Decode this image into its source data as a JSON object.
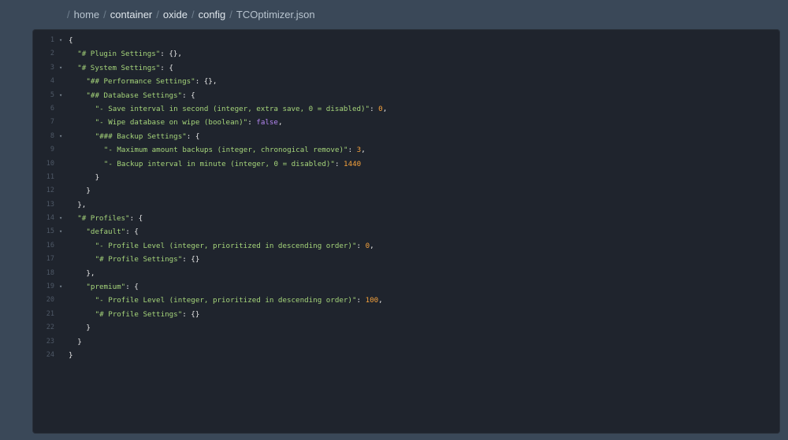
{
  "breadcrumb": {
    "segments": [
      {
        "label": "home",
        "weight": "dim"
      },
      {
        "label": "container",
        "weight": "strong"
      },
      {
        "label": "oxide",
        "weight": "strong"
      },
      {
        "label": "config",
        "weight": "strong"
      },
      {
        "label": "TCOptimizer.json",
        "weight": "dim"
      }
    ],
    "separator": "/"
  },
  "colors": {
    "background": "#3a4858",
    "editor": "#1f242d",
    "string": "#a5d47a",
    "number": "#f4a13c",
    "boolean": "#b385f0"
  },
  "editor": {
    "file": "TCOptimizer.json",
    "lines": [
      {
        "n": "1",
        "fold": true,
        "indent": 0,
        "tokens": [
          [
            "p",
            "{"
          ]
        ]
      },
      {
        "n": "2",
        "fold": false,
        "indent": 1,
        "tokens": [
          [
            "s",
            "\"# Plugin Settings\""
          ],
          [
            "p",
            ": {},"
          ]
        ]
      },
      {
        "n": "3",
        "fold": true,
        "indent": 1,
        "tokens": [
          [
            "s",
            "\"# System Settings\""
          ],
          [
            "p",
            ": {"
          ]
        ]
      },
      {
        "n": "4",
        "fold": false,
        "indent": 2,
        "tokens": [
          [
            "s",
            "\"## Performance Settings\""
          ],
          [
            "p",
            ": {},"
          ]
        ]
      },
      {
        "n": "5",
        "fold": true,
        "indent": 2,
        "tokens": [
          [
            "s",
            "\"## Database Settings\""
          ],
          [
            "p",
            ": {"
          ]
        ]
      },
      {
        "n": "6",
        "fold": false,
        "indent": 3,
        "tokens": [
          [
            "s",
            "\"- Save interval in second (integer, extra save, 0 = disabled)\""
          ],
          [
            "p",
            ": "
          ],
          [
            "n",
            "0"
          ],
          [
            "p",
            ","
          ]
        ]
      },
      {
        "n": "7",
        "fold": false,
        "indent": 3,
        "tokens": [
          [
            "s",
            "\"- Wipe database on wipe (boolean)\""
          ],
          [
            "p",
            ": "
          ],
          [
            "b",
            "false"
          ],
          [
            "p",
            ","
          ]
        ]
      },
      {
        "n": "8",
        "fold": true,
        "indent": 3,
        "tokens": [
          [
            "s",
            "\"### Backup Settings\""
          ],
          [
            "p",
            ": {"
          ]
        ]
      },
      {
        "n": "9",
        "fold": false,
        "indent": 4,
        "tokens": [
          [
            "s",
            "\"- Maximum amount backups (integer, chronogical remove)\""
          ],
          [
            "p",
            ": "
          ],
          [
            "n",
            "3"
          ],
          [
            "p",
            ","
          ]
        ]
      },
      {
        "n": "10",
        "fold": false,
        "indent": 4,
        "tokens": [
          [
            "s",
            "\"- Backup interval in minute (integer, 0 = disabled)\""
          ],
          [
            "p",
            ": "
          ],
          [
            "n",
            "1440"
          ]
        ]
      },
      {
        "n": "11",
        "fold": false,
        "indent": 3,
        "tokens": [
          [
            "p",
            "}"
          ]
        ]
      },
      {
        "n": "12",
        "fold": false,
        "indent": 2,
        "tokens": [
          [
            "p",
            "}"
          ]
        ]
      },
      {
        "n": "13",
        "fold": false,
        "indent": 1,
        "tokens": [
          [
            "p",
            "},"
          ]
        ]
      },
      {
        "n": "14",
        "fold": true,
        "indent": 1,
        "tokens": [
          [
            "s",
            "\"# Profiles\""
          ],
          [
            "p",
            ": {"
          ]
        ]
      },
      {
        "n": "15",
        "fold": true,
        "indent": 2,
        "tokens": [
          [
            "s",
            "\"default\""
          ],
          [
            "p",
            ": {"
          ]
        ]
      },
      {
        "n": "16",
        "fold": false,
        "indent": 3,
        "tokens": [
          [
            "s",
            "\"- Profile Level (integer, prioritized in descending order)\""
          ],
          [
            "p",
            ": "
          ],
          [
            "n",
            "0"
          ],
          [
            "p",
            ","
          ]
        ]
      },
      {
        "n": "17",
        "fold": false,
        "indent": 3,
        "tokens": [
          [
            "s",
            "\"# Profile Settings\""
          ],
          [
            "p",
            ": {}"
          ]
        ]
      },
      {
        "n": "18",
        "fold": false,
        "indent": 2,
        "tokens": [
          [
            "p",
            "},"
          ]
        ]
      },
      {
        "n": "19",
        "fold": true,
        "indent": 2,
        "tokens": [
          [
            "s",
            "\"premium\""
          ],
          [
            "p",
            ": {"
          ]
        ]
      },
      {
        "n": "20",
        "fold": false,
        "indent": 3,
        "tokens": [
          [
            "s",
            "\"- Profile Level (integer, prioritized in descending order)\""
          ],
          [
            "p",
            ": "
          ],
          [
            "n",
            "100"
          ],
          [
            "p",
            ","
          ]
        ]
      },
      {
        "n": "21",
        "fold": false,
        "indent": 3,
        "tokens": [
          [
            "s",
            "\"# Profile Settings\""
          ],
          [
            "p",
            ": {}"
          ]
        ]
      },
      {
        "n": "22",
        "fold": false,
        "indent": 2,
        "tokens": [
          [
            "p",
            "}"
          ]
        ]
      },
      {
        "n": "23",
        "fold": false,
        "indent": 1,
        "tokens": [
          [
            "p",
            "}"
          ]
        ]
      },
      {
        "n": "24",
        "fold": false,
        "indent": 0,
        "tokens": [
          [
            "p",
            "}"
          ]
        ]
      }
    ]
  }
}
